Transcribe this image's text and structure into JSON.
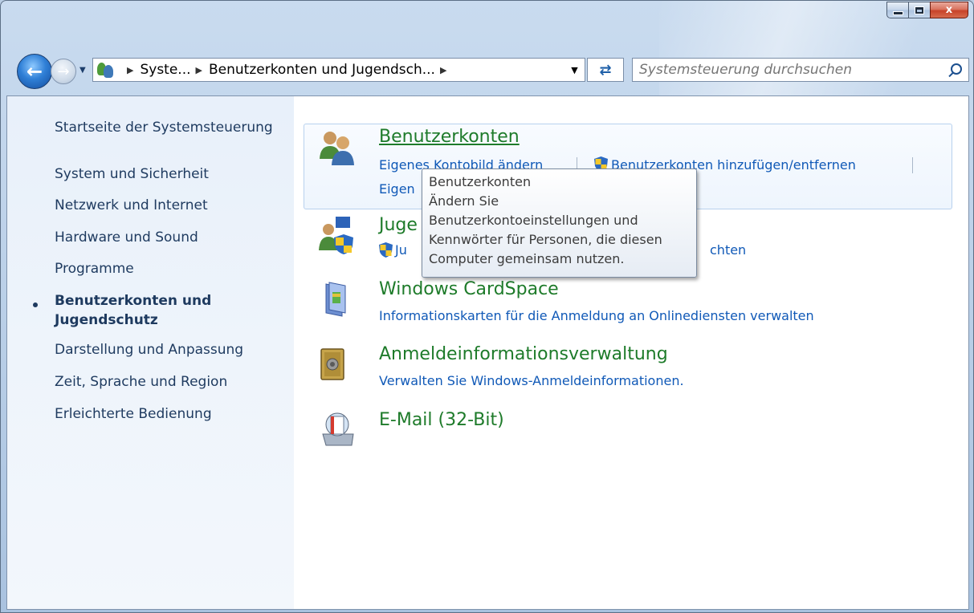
{
  "window": {
    "caption": {
      "close_glyph": "x"
    }
  },
  "nav": {
    "breadcrumbs": [
      "Syste...",
      "Benutzerkonten und Jugendsch..."
    ],
    "search_placeholder": "Systemsteuerung durchsuchen"
  },
  "sidebar": {
    "items": [
      {
        "label": "Startseite der Systemsteuerung"
      },
      {
        "label": "System und Sicherheit"
      },
      {
        "label": "Netzwerk und Internet"
      },
      {
        "label": "Hardware und Sound"
      },
      {
        "label": "Programme"
      },
      {
        "label": "Benutzerkonten und Jugendschutz",
        "current": true
      },
      {
        "label": "Darstellung und Anpassung"
      },
      {
        "label": "Zeit, Sprache und Region"
      },
      {
        "label": "Erleichterte Bedienung"
      }
    ]
  },
  "categories": [
    {
      "title": "Benutzerkonten",
      "icon": "user-accounts-icon",
      "links": [
        "Eigenes Kontobild ändern",
        "Benutzerkonten hinzufügen/entfernen",
        "Eigen"
      ]
    },
    {
      "title": "Juge",
      "icon": "parental-controls-icon",
      "links": [
        "Ju",
        "chten"
      ]
    },
    {
      "title": "Windows CardSpace",
      "icon": "cardspace-icon",
      "links": [
        "Informationskarten für die Anmeldung an Onlinediensten verwalten"
      ]
    },
    {
      "title": "Anmeldeinformationsverwaltung",
      "icon": "credential-vault-icon",
      "links": [
        "Verwalten Sie Windows-Anmeldeinformationen."
      ]
    },
    {
      "title": "E-Mail (32-Bit)",
      "icon": "mail-icon",
      "links": []
    }
  ],
  "tooltip": {
    "lines": [
      "Benutzerkonten",
      "Ändern Sie",
      "Benutzerkontoeinstellungen und",
      "Kennwörter für Personen, die diesen",
      "Computer gemeinsam nutzen."
    ]
  },
  "colors": {
    "title_green": "#1e7b2a",
    "link_blue": "#1059b7",
    "sidebar_text": "#1e3a5f",
    "close_red": "#c7432a"
  }
}
